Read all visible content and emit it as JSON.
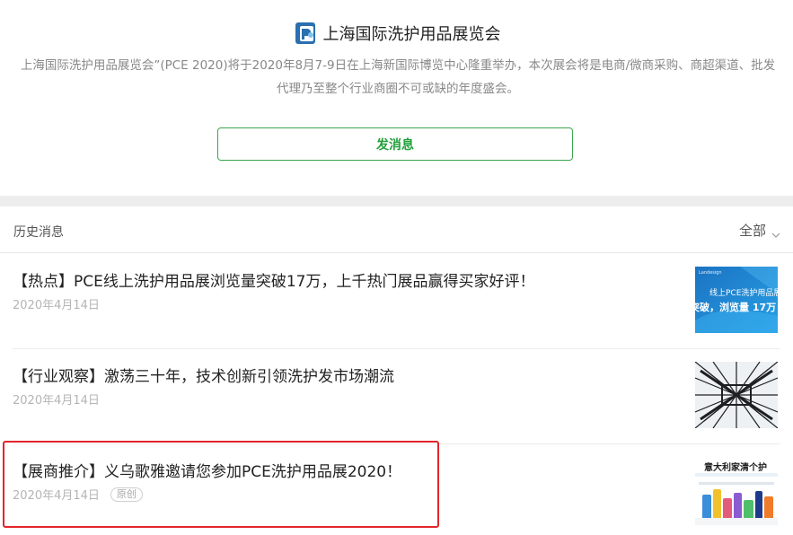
{
  "account": {
    "name": "上海国际洗护用品展览会",
    "description": "上海国际洗护用品展览会”(PCE 2020)将于2020年8月7-9日在上海新国际博览中心隆重举办，本次展会将是电商/微商采购、商超渠道、批发代理乃至整个行业商圈不可或缺的年度盛会。",
    "send_button_label": "发消息"
  },
  "history": {
    "title": "历史消息",
    "filter_label": "全部"
  },
  "articles": [
    {
      "title": "【热点】PCE线上洗护用品展浏览量突破17万，上千热门展品赢得买家好评！",
      "date": "2020年4月14日",
      "thumb_line1": "线上PCE洗护用品展",
      "thumb_line2": "突破，浏览量 17万"
    },
    {
      "title": "【行业观察】激荡三十年，技术创新引领洗护发市场潮流",
      "date": "2020年4月14日"
    },
    {
      "title": "【展商推介】义乌歌雅邀请您参加PCE洗护用品展2020！",
      "date": "2020年4月14日",
      "tag": "原创",
      "thumb_line1": "意大利家清个护"
    }
  ],
  "colors": {
    "accent_green": "#21a03a",
    "highlight_red": "#e4242a",
    "thumb_blue": "#1f86d3"
  }
}
